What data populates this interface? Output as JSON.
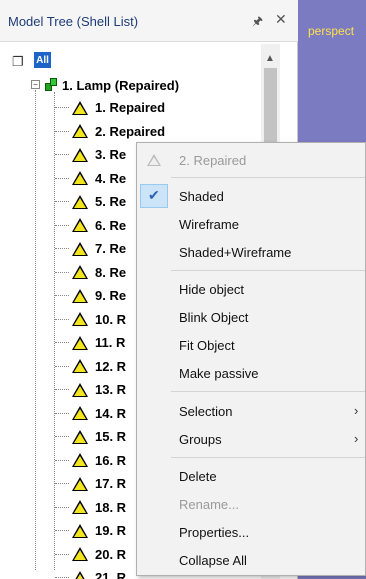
{
  "panel": {
    "title": "Model Tree (Shell List)",
    "pin_icon": "pin-icon",
    "close_label": "✕"
  },
  "viewport": {
    "label": "perspect"
  },
  "tree": {
    "all_label": "All",
    "root_label": "1. Lamp (Repaired)",
    "items": [
      "1. Repaired",
      "2. Repaired",
      "3. Re",
      "4. Re",
      "5. Re",
      "6. Re",
      "7. Re",
      "8. Re",
      "9. Re",
      "10. R",
      "11. R",
      "12. R",
      "13. R",
      "14. R",
      "15. R",
      "16. R",
      "17. R",
      "18. R",
      "19. R",
      "20. R",
      "21. R"
    ],
    "triangle_color": "#f2e520"
  },
  "context_menu": {
    "header": "2. Repaired",
    "shaded": "Shaded",
    "wireframe": "Wireframe",
    "shaded_wireframe": "Shaded+Wireframe",
    "hide_object": "Hide object",
    "blink_object": "Blink Object",
    "fit_object": "Fit Object",
    "make_passive": "Make passive",
    "selection": "Selection",
    "groups": "Groups",
    "delete": "Delete",
    "rename": "Rename...",
    "properties": "Properties...",
    "collapse_all": "Collapse All"
  }
}
